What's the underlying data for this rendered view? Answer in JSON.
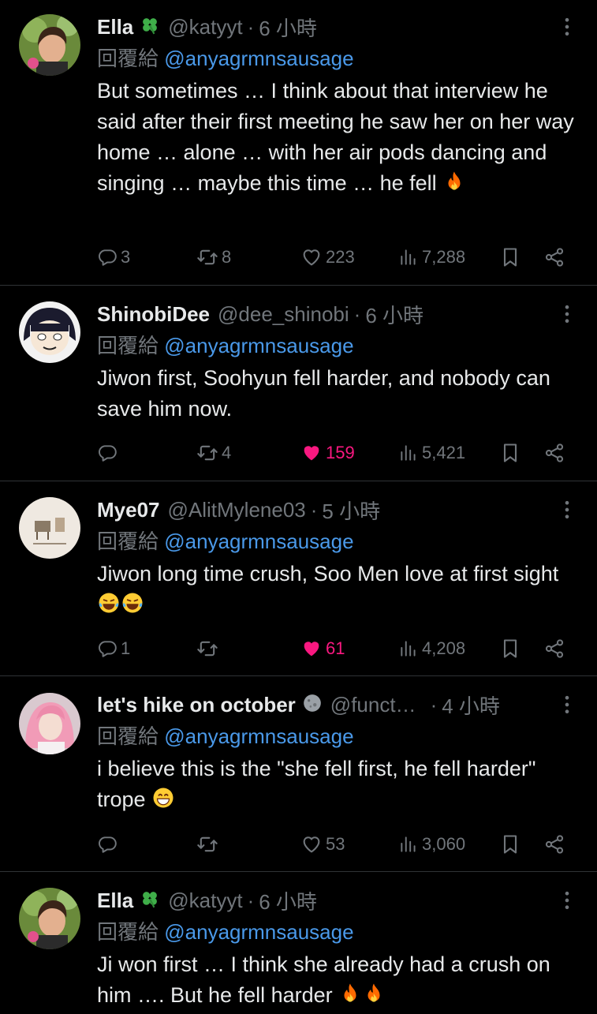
{
  "accent": {
    "link": "#4a99e9",
    "like": "#f91880",
    "muted": "#71767b",
    "text": "#e7e9ea",
    "divider": "#2f3336"
  },
  "reply_prefix": "回覆給",
  "tweets": [
    {
      "name": "Ella",
      "name_emoji": "four-leaf-clover-icon",
      "handle": "@katyyt",
      "dot": "·",
      "time": "6 小時",
      "reply_to": "@anyagrmnsausage",
      "text": "But sometimes … I think about that interview he said after their first meeting he saw her on her way home … alone … with her air pods dancing and singing … maybe this time … he fell",
      "text_emoji": "fire-icon",
      "replies": "3",
      "retweets": "8",
      "likes": "223",
      "views": "7,288",
      "liked": false
    },
    {
      "name": "ShinobiDee",
      "handle": "@dee_shinobi",
      "dot": "·",
      "time": "6 小時",
      "reply_to": "@anyagrmnsausage",
      "text": "Jiwon first, Soohyun fell harder, and nobody can save him now.",
      "replies": "",
      "retweets": "4",
      "likes": "159",
      "views": "5,421",
      "liked": true
    },
    {
      "name": "Mye07",
      "handle": "@AlitMylene03",
      "dot": "·",
      "time": "5 小時",
      "reply_to": "@anyagrmnsausage",
      "text": "Jiwon long time crush, Soo Men love at first sight",
      "text_emoji": "laughing-tears-icon",
      "replies": "1",
      "retweets": "",
      "likes": "61",
      "views": "4,208",
      "liked": true
    },
    {
      "name": "let's hike on october",
      "name_emoji": "moon-face-icon",
      "handle": "@funct…",
      "dot": "·",
      "time": "4 小時",
      "reply_to": "@anyagrmnsausage",
      "text": "i believe this is the \"she fell first, he fell harder\" trope",
      "text_emoji": "grinning-icon",
      "replies": "",
      "retweets": "",
      "likes": "53",
      "views": "3,060",
      "liked": false
    },
    {
      "name": "Ella",
      "name_emoji": "four-leaf-clover-icon",
      "handle": "@katyyt",
      "dot": "·",
      "time": "6 小時",
      "reply_to": "@anyagrmnsausage",
      "text": "Ji won first … I think she already had a crush on him …. But he fell harder",
      "text_emoji": "fire-icon"
    }
  ]
}
